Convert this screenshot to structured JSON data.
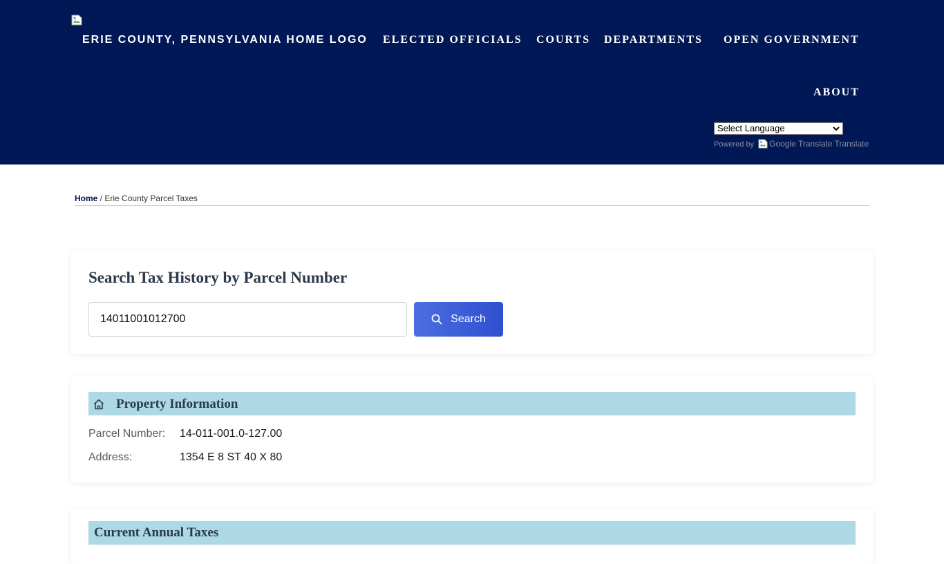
{
  "header": {
    "logo_alt": "ERIE COUNTY, PENNSYLVANIA HOME LOGO",
    "logo_icon": "broken-image-icon",
    "nav": [
      {
        "label": "ELECTED OFFICIALS"
      },
      {
        "label": "COURTS"
      },
      {
        "label": "DEPARTMENTS"
      },
      {
        "label": "OPEN GOVERNMENT"
      },
      {
        "label": "ABOUT"
      }
    ],
    "language_select": {
      "selected": "Select Language"
    },
    "translate": {
      "powered_by": "Powered by",
      "google_alt": "Google Translate",
      "link": "Translate"
    }
  },
  "breadcrumb": {
    "home": "Home",
    "separator": " / ",
    "current": "Erie County Parcel Taxes"
  },
  "search": {
    "title": "Search Tax History by Parcel Number",
    "input_value": "14011001012700",
    "button_label": "Search",
    "button_icon": "search-icon"
  },
  "property": {
    "section_title": "Property Information",
    "section_icon": "home-icon",
    "fields": [
      {
        "label": "Parcel Number:",
        "value": "14-011-001.0-127.00"
      },
      {
        "label": "Address:",
        "value": "1354 E 8 ST 40 X 80"
      }
    ]
  },
  "next_section": {
    "title": "Current Annual Taxes"
  },
  "colors": {
    "header_bg": "#001855",
    "section_bar": "#add8e6",
    "button_start": "#4b6fe0",
    "button_end": "#2f4fcf"
  }
}
